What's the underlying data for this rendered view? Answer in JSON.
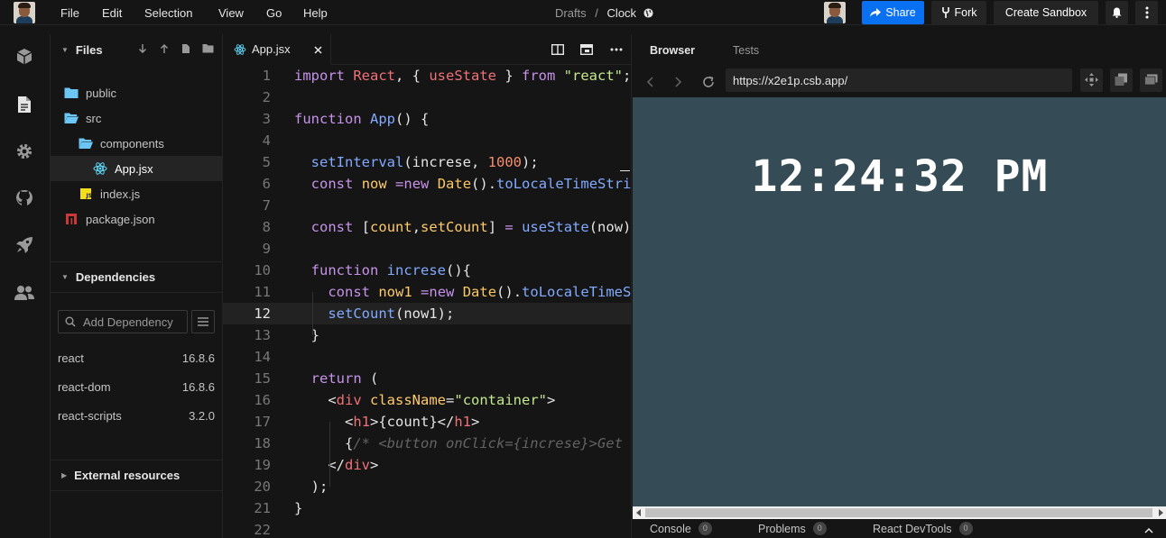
{
  "topbar": {
    "menu": [
      "File",
      "Edit",
      "Selection",
      "View",
      "Go",
      "Help"
    ],
    "breadcrumb_folder": "Drafts",
    "breadcrumb_sep": "/",
    "sandbox_name": "Clock",
    "share_label": "Share",
    "fork_label": "Fork",
    "create_label": "Create Sandbox",
    "share_color": "#0971f1"
  },
  "activity": {
    "icons": [
      "cube-icon",
      "file-icon",
      "gear-icon",
      "github-icon",
      "rocket-icon",
      "users-icon"
    ]
  },
  "sidebar": {
    "files_title": "Files",
    "tree": [
      {
        "label": "public",
        "type": "folder"
      },
      {
        "label": "src",
        "type": "folder-open"
      },
      {
        "label": "components",
        "type": "folder-open"
      },
      {
        "label": "App.jsx",
        "type": "react"
      },
      {
        "label": "index.js",
        "type": "js"
      },
      {
        "label": "package.json",
        "type": "npm"
      }
    ],
    "dependencies_title": "Dependencies",
    "add_dependency_placeholder": "Add Dependency",
    "dependencies": [
      {
        "name": "react",
        "version": "16.8.6"
      },
      {
        "name": "react-dom",
        "version": "16.8.6"
      },
      {
        "name": "react-scripts",
        "version": "3.2.0"
      }
    ],
    "external_title": "External resources"
  },
  "editor": {
    "tab_label": "App.jsx",
    "current_line": 12,
    "line_numbers": [
      "1",
      "2",
      "3",
      "4",
      "5",
      "6",
      "7",
      "8",
      "9",
      "10",
      "11",
      "12",
      "13",
      "14",
      "15",
      "16",
      "17",
      "18",
      "19",
      "20",
      "21",
      "22"
    ]
  },
  "preview": {
    "browser_tab": "Browser",
    "tests_tab": "Tests",
    "url": "https://x2e1p.csb.app/",
    "clock_text": "12:24:32 PM",
    "frame_color": "#354c56",
    "console_tabs": [
      {
        "label": "Console",
        "count": "0"
      },
      {
        "label": "Problems",
        "count": "0"
      },
      {
        "label": "React DevTools",
        "count": "0"
      }
    ]
  }
}
